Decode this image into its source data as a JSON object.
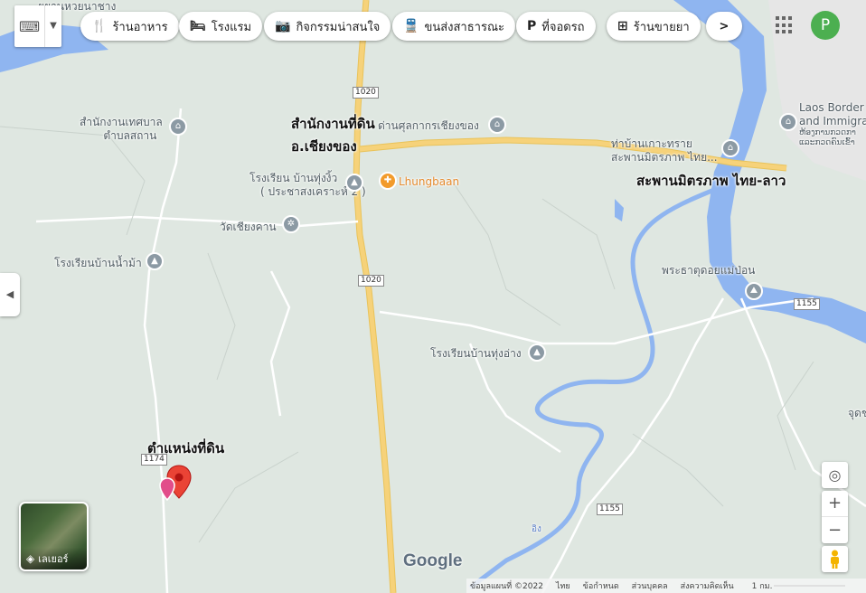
{
  "toolbar": {
    "chips": [
      {
        "label": "ร้านอาหาร",
        "icon": "fork-knife-icon"
      },
      {
        "label": "โรงแรม",
        "icon": "bed-icon"
      },
      {
        "label": "กิจกรรมน่าสนใจ",
        "icon": "camera-icon"
      },
      {
        "label": "ขนส่งสาธารณะ",
        "icon": "train-icon"
      },
      {
        "label": "ที่จอดรถ",
        "icon": "parking-icon"
      },
      {
        "label": "ร้านขายยา",
        "icon": "pharmacy-icon"
      }
    ],
    "next_label": ">",
    "apps_icon": "grid-icon",
    "avatar_letter": "P",
    "avatar_color": "#4caf50"
  },
  "map": {
    "colors": {
      "land": "#dfe7e1",
      "water": "#8fb5f0",
      "road_major": "#f6d27a",
      "road_minor": "#ffffff"
    },
    "labels": {
      "top_road": "ยยานหวยนาชาง",
      "office_tambon_1": "สำนักงานเทศบาล",
      "office_tambon_2": "ตำบลสถาน",
      "land_office_1": "สำนักงานที่ดิน",
      "land_office_2": "อ.เชียงของ",
      "customs": "ด่านศุลกากรเชียงของ",
      "school_tungngio_1": "โรงเรียน บ้านทุ่งงิ้ว",
      "school_tungngio_2": "( ประชาสงเคราะห์ 2 )",
      "lhungbaan": "Lhungbaan",
      "wat": "วัดเชียงคาน",
      "school_nammam": "โรงเรียนบ้านน้ำม้า",
      "pier_1": "ท่าบ้านเกาะทราย",
      "pier_2": "สะพานมิตรภาพ ไทย...",
      "bridge": "สะพานมิตรภาพ ไทย-ลาว",
      "laos_1": "Laos Border",
      "laos_2": "and Immigra",
      "laos_3": "ຫ້ອງການກວດກາ",
      "laos_4": "ແລະກວດຄົນເຂົ້າ",
      "temple": "พระธาตุดอยแม่ป่อน",
      "school_tungang": "โรงเรียนบ้านทุ่งอ่าง",
      "parcel": "ตำแหน่งที่ดิน",
      "edge": "จุดช",
      "river": "อิง"
    },
    "shields": [
      "1020",
      "1020",
      "1155",
      "1174",
      "1155"
    ]
  },
  "layer": {
    "label": "เลเยอร์"
  },
  "logo": "Google",
  "footer": {
    "items": [
      "ข้อมูลแผนที่ ©2022",
      "ไทย",
      "ข้อกำหนด",
      "ส่วนบุคคล",
      "ส่งความคิดเห็น"
    ],
    "scale": "1 กม."
  }
}
